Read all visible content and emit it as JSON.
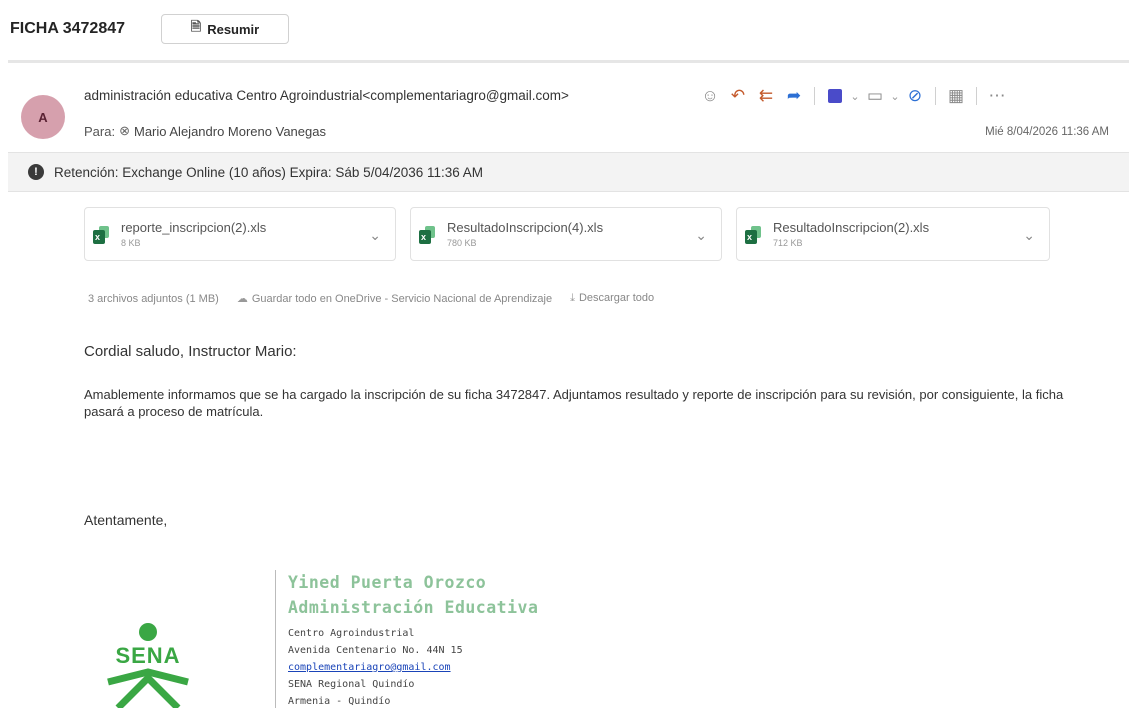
{
  "header": {
    "subject": "FICHA 3472847",
    "summarize_label": "Resumir"
  },
  "message": {
    "avatar_initial": "A",
    "sender": "administración educativa Centro Agroindustrial<complementariagro@gmail.com>",
    "to_label": "Para:",
    "to_name": "Mario Alejandro Moreno Vanegas",
    "date": "Mié 8/04/2026 11:36 AM",
    "retention": "Retención: Exchange Online (10 años) Expira: Sáb 5/04/2036 11:36 AM"
  },
  "attachments": [
    {
      "name": "reporte_inscripcion(2).xls",
      "size": "8 KB"
    },
    {
      "name": "ResultadoInscripcion(4).xls",
      "size": "780 KB"
    },
    {
      "name": "ResultadoInscripcion(2).xls",
      "size": "712 KB"
    }
  ],
  "attachment_meta": {
    "count": "3 archivos adjuntos (1 MB)",
    "save_all": "Guardar todo en OneDrive - Servicio Nacional de Aprendizaje",
    "download_all": "Descargar todo"
  },
  "body": {
    "greeting": "Cordial saludo, Instructor Mario:",
    "paragraph": "Amablemente informamos que se ha cargado la inscripción de su ficha 3472847. Adjuntamos resultado y reporte de inscripción para su revisión, por consiguiente, la ficha pasará a proceso de matrícula.",
    "closing": "Atentamente,"
  },
  "signature": {
    "name": "Yined Puerta Orozco",
    "role": "Administración Educativa",
    "line1": "Centro Agroindustrial",
    "line2": "Avenida Centenario No. 44N 15",
    "email": "complementariagro@gmail.com",
    "line3": "SENA Regional Quindío",
    "line4": "Armenia - Quindío",
    "logo_text": "SENA"
  },
  "colors": {
    "avatar_bg": "#d6a0ad",
    "reply_accent": "#c45a2c",
    "signature_green": "#8dc39a",
    "sena_green": "#3aa744"
  }
}
